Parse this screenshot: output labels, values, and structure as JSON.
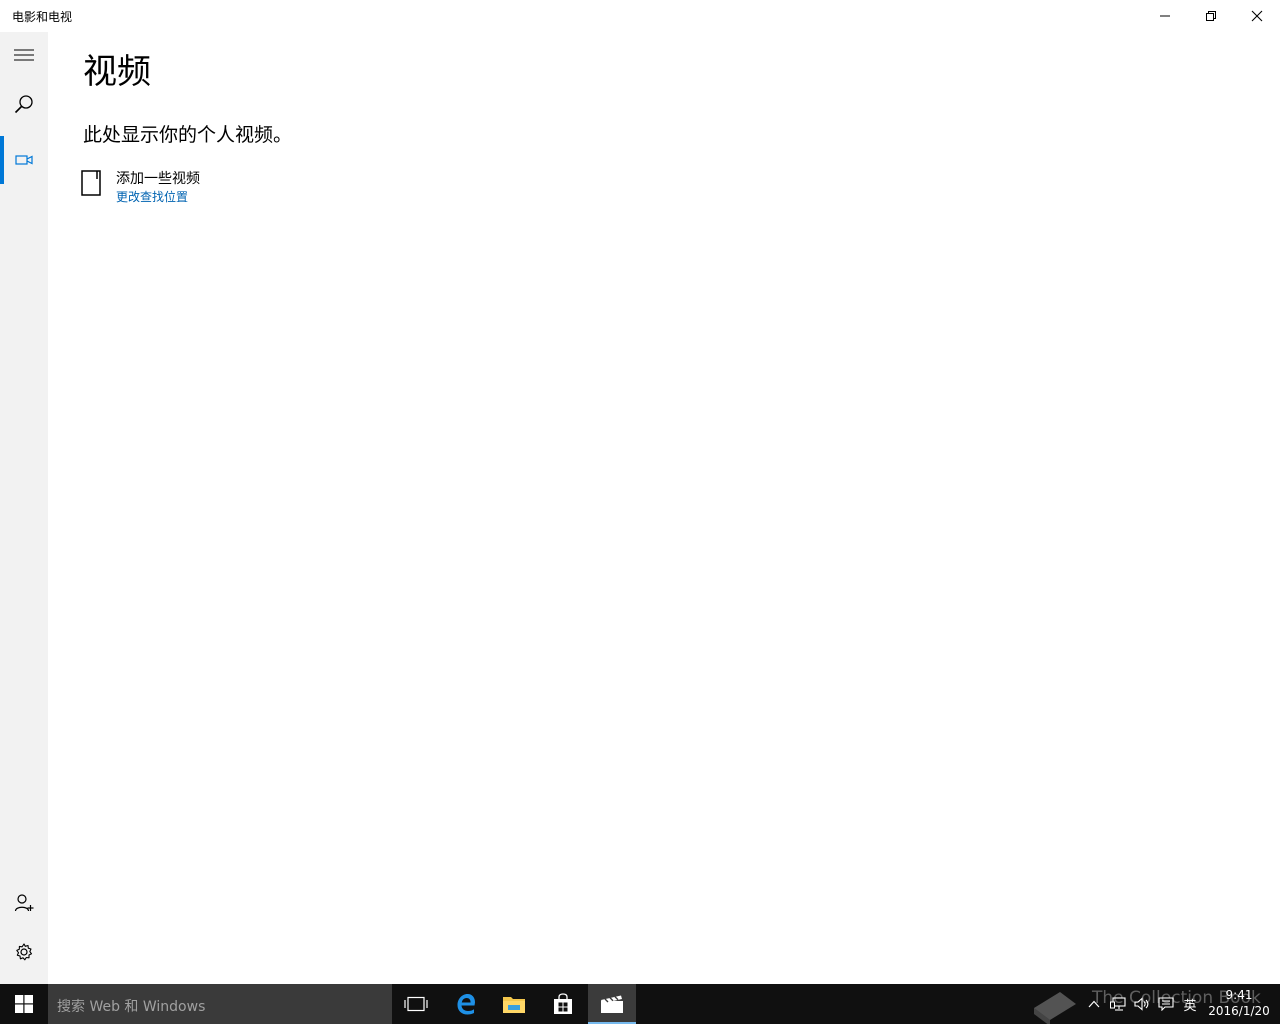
{
  "window": {
    "title": "电影和电视",
    "controls": [
      "minimize-icon",
      "restore-icon",
      "close-icon"
    ]
  },
  "nav": {
    "items": [
      {
        "icon": "hamburger-menu-icon"
      },
      {
        "icon": "search-icon"
      },
      {
        "icon": "video-camera-icon",
        "selected": true
      },
      {
        "icon": "add-account-icon"
      },
      {
        "icon": "gear-icon"
      }
    ],
    "accent": "#0078d7"
  },
  "main": {
    "title": "视频",
    "empty_message": "此处显示你的个人视频。",
    "add_videos_label": "添加一些视频",
    "change_location_link": "更改查找位置"
  },
  "taskbar": {
    "search_placeholder": "搜索 Web 和 Windows",
    "pinned": [
      "task-view-icon",
      "edge-icon",
      "file-explorer-icon",
      "store-icon",
      "movies-tv-icon"
    ],
    "tray": {
      "ime_label": "英",
      "time": "9:41",
      "date": "2016/1/20"
    }
  },
  "watermark": {
    "text": "The Collection Book"
  },
  "colors": {
    "link": "#0063b1",
    "taskbar": "#101010",
    "nav_bg": "#f2f2f2"
  }
}
